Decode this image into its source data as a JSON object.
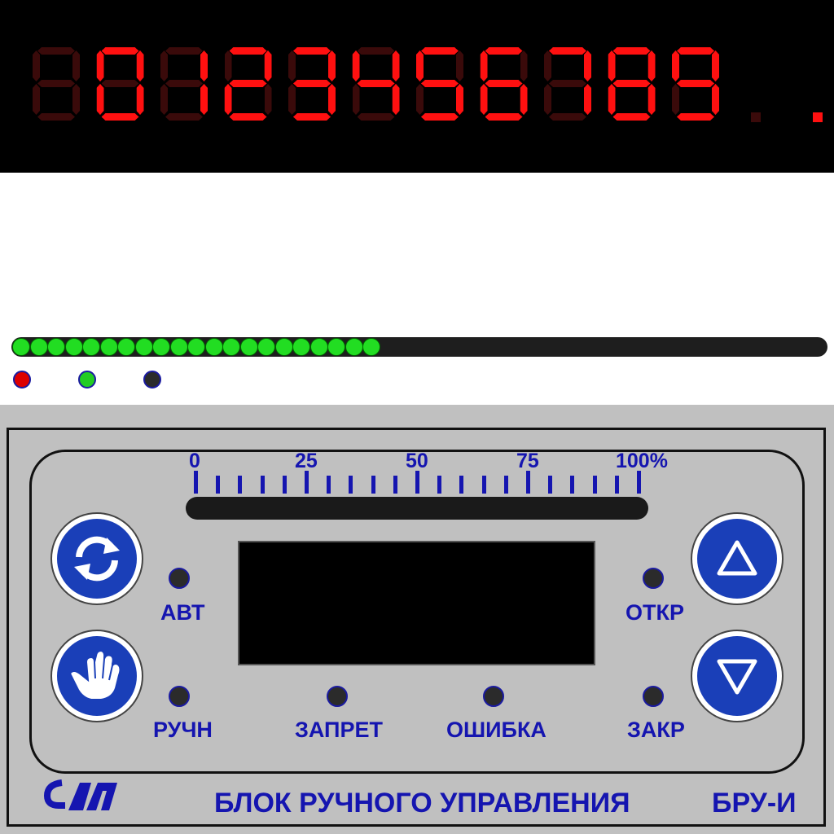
{
  "segment_display": {
    "digits": [
      "8",
      "0",
      "1",
      "2",
      "3",
      "4",
      "5",
      "6",
      "7",
      "8",
      "9"
    ],
    "lit": [
      false,
      true,
      true,
      true,
      true,
      true,
      true,
      true,
      true,
      true,
      true
    ],
    "decimal_points_lit": [
      false,
      true
    ],
    "color_on": "#ff1010",
    "color_off": "#3a0a0a"
  },
  "led_bar": {
    "total_leds": 44,
    "lit_leds": 21,
    "fill_fraction": 0.477,
    "lit_color": "#22dd22"
  },
  "indicators": [
    {
      "name": "red",
      "color": "#dd0000"
    },
    {
      "name": "green",
      "color": "#22cc22"
    },
    {
      "name": "dark",
      "color": "#2b2b2b"
    }
  ],
  "panel": {
    "scale": {
      "labels": [
        "0",
        "25",
        "50",
        "75",
        "100%"
      ],
      "tick_count": 21
    },
    "buttons": {
      "auto_icon": "refresh-arrows-icon",
      "manual_icon": "hand-icon",
      "up_icon": "triangle-up-icon",
      "down_icon": "triangle-down-icon"
    },
    "leds": {
      "avt": "АВТ",
      "ruchn": "РУЧН",
      "zapret": "ЗАПРЕТ",
      "oshibka": "ОШИБКА",
      "otkr": "ОТКР",
      "zakr": "ЗАКР"
    },
    "title": "БЛОК РУЧНОГО УПРАВЛЕНИЯ",
    "model": "БРУ-И",
    "accent_color": "#1515b0"
  }
}
